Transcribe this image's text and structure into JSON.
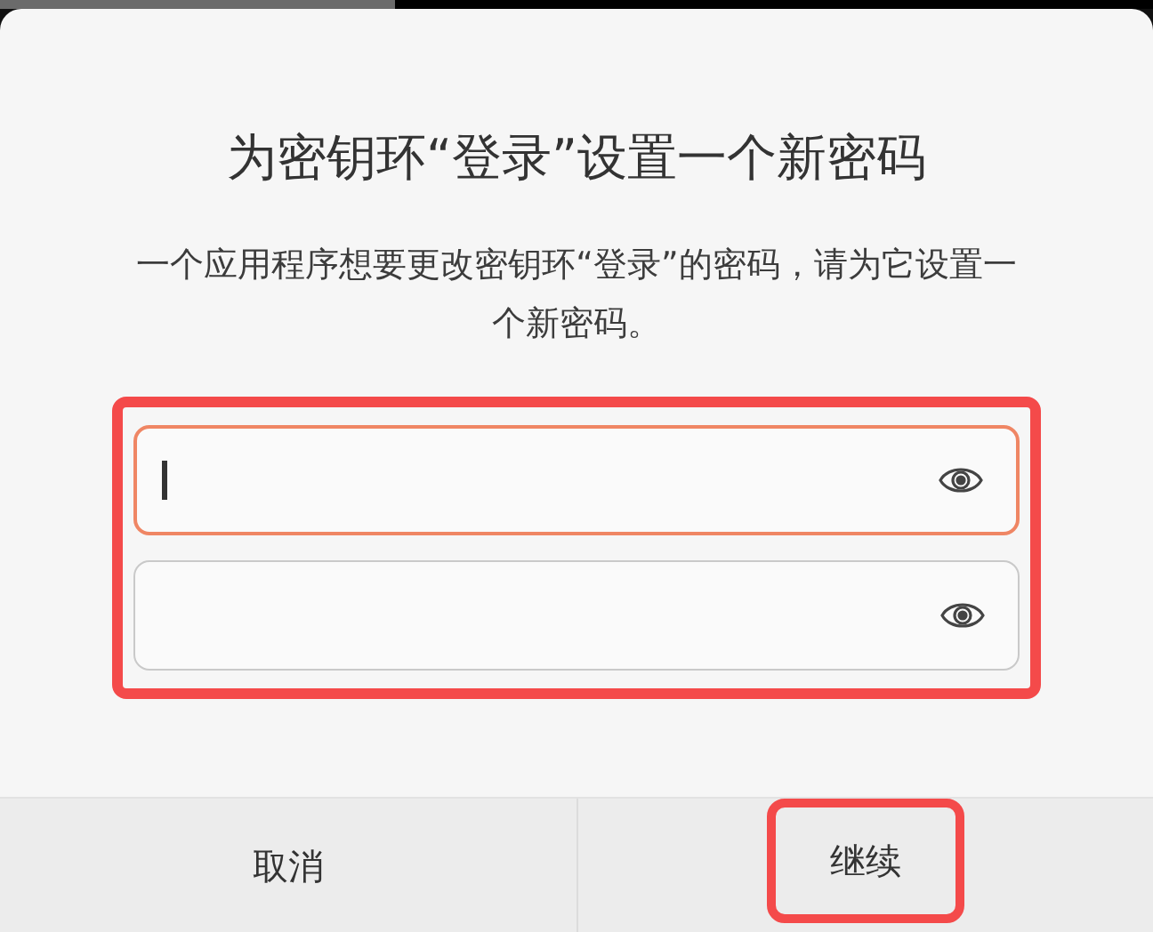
{
  "dialog": {
    "title": "为密钥环“登录”设置一个新密码",
    "description": "一个应用程序想要更改密钥环“登录”的密码，请为它设置一个新密码。",
    "password_fields_highlighted": true,
    "password_fields": [
      {
        "focused": true
      },
      {
        "focused": false
      }
    ],
    "buttons": [
      {
        "label": "取消",
        "highlighted": false
      },
      {
        "label": "继续",
        "highlighted": true
      }
    ]
  }
}
